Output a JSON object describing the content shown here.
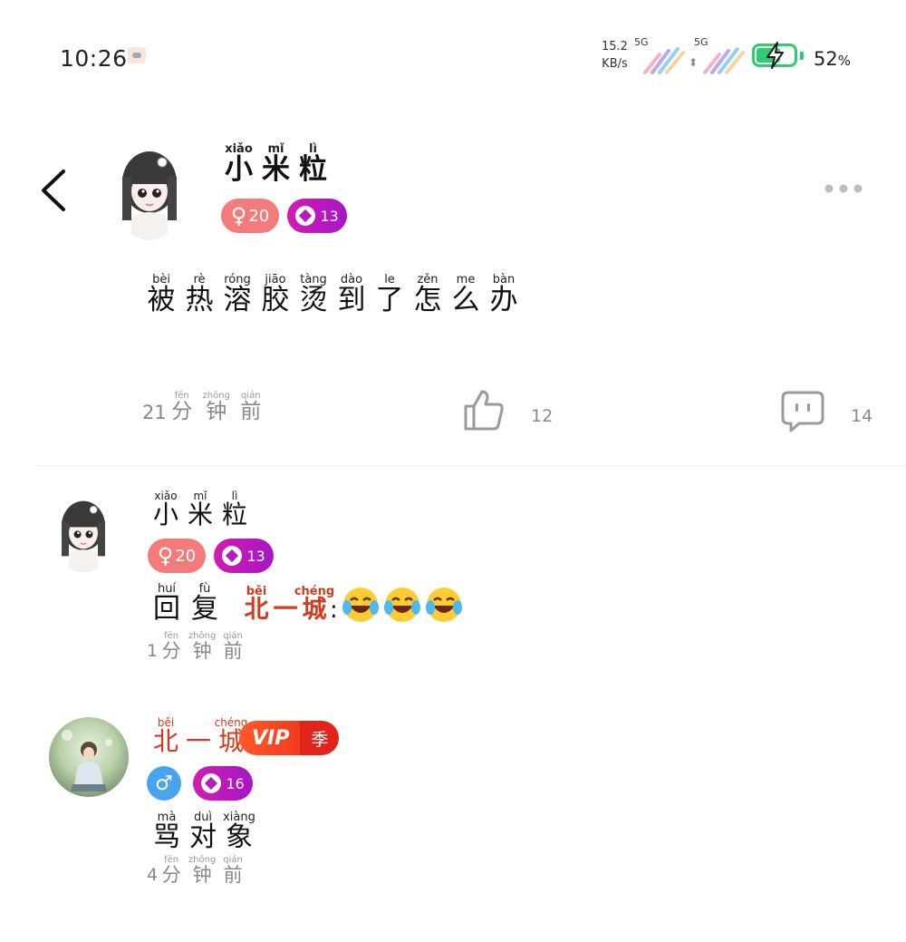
{
  "status_bar": {
    "time": "10:26",
    "net_speed_value": "15.2",
    "net_speed_unit": "KB/s",
    "sim1_label": "5G",
    "sim2_label": "5G",
    "battery_percent": "52",
    "battery_percent_sign": "%"
  },
  "post": {
    "author": {
      "name": [
        {
          "py": "xiǎo",
          "hz": "小"
        },
        {
          "py": "mǐ",
          "hz": "米"
        },
        {
          "py": "lì",
          "hz": "粒"
        }
      ],
      "gender_badge": "20",
      "level_badge": "13"
    },
    "content": [
      {
        "py": "bèi",
        "hz": "被"
      },
      {
        "py": "rè",
        "hz": "热"
      },
      {
        "py": "róng",
        "hz": "溶"
      },
      {
        "py": "jiāo",
        "hz": "胶"
      },
      {
        "py": "tàng",
        "hz": "烫"
      },
      {
        "py": "dào",
        "hz": "到"
      },
      {
        "py": "le",
        "hz": "了"
      },
      {
        "py": "zěn",
        "hz": "怎"
      },
      {
        "py": "me",
        "hz": "么"
      },
      {
        "py": "bàn",
        "hz": "办"
      }
    ],
    "time_number": "21",
    "time_unit": [
      {
        "py": "fēn",
        "hz": "分"
      },
      {
        "py": "zhōng",
        "hz": "钟"
      },
      {
        "py": "qián",
        "hz": "前"
      }
    ],
    "like_count": "12",
    "comment_count": "14"
  },
  "replies": [
    {
      "author_name": [
        {
          "py": "xiǎo",
          "hz": "小"
        },
        {
          "py": "mǐ",
          "hz": "米"
        },
        {
          "py": "lì",
          "hz": "粒"
        }
      ],
      "gender_badge": "20",
      "level_badge": "13",
      "reply_prefix": [
        {
          "py": "huí",
          "hz": "回"
        },
        {
          "py": "fù",
          "hz": "复"
        }
      ],
      "reply_target": [
        {
          "py": "běi",
          "hz": "北"
        },
        {
          "py": "",
          "hz": "一"
        },
        {
          "py": "chéng",
          "hz": "城"
        }
      ],
      "colon": ":",
      "emoji_icons": [
        "laughing-crying-emoji",
        "laughing-crying-emoji",
        "laughing-crying-emoji"
      ],
      "time_number": "1",
      "time_unit": [
        {
          "py": "fēn",
          "hz": "分"
        },
        {
          "py": "zhōng",
          "hz": "钟"
        },
        {
          "py": "qián",
          "hz": "前"
        }
      ]
    },
    {
      "author_name": [
        {
          "py": "běi",
          "hz": "北"
        },
        {
          "py": "",
          "hz": "一"
        },
        {
          "py": "chéng",
          "hz": "城"
        }
      ],
      "vip_label": "VIP",
      "vip_season": "季",
      "gender_badge": "",
      "level_badge": "16",
      "content": [
        {
          "py": "mà",
          "hz": "骂"
        },
        {
          "py": "duì",
          "hz": "对"
        },
        {
          "py": "xiàng",
          "hz": "象"
        }
      ],
      "time_number": "4",
      "time_unit": [
        {
          "py": "fēn",
          "hz": "分"
        },
        {
          "py": "zhōng",
          "hz": "钟"
        },
        {
          "py": "qián",
          "hz": "前"
        }
      ]
    }
  ],
  "colors": {
    "female_badge": "#f47b7b",
    "male_badge": "#4aa3ef",
    "level_badge": "#b51dbb",
    "reply_target_name": "#d43a1e",
    "battery": "#2ecc71",
    "vip": "#f23b1c"
  }
}
